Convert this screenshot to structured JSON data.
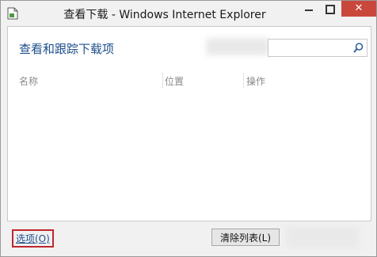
{
  "window": {
    "title": "查看下载 - Windows Internet Explorer",
    "close_glyph": "✕",
    "accent_close": "#c9483c"
  },
  "header": {
    "title": "查看和跟踪下载项",
    "search_placeholder": ""
  },
  "columns": [
    "名称",
    "位置",
    "操作"
  ],
  "footer": {
    "options_label": "选项(O)",
    "clear_list_label": "清除列表(L)"
  },
  "icons": {
    "app": "ie-page-icon",
    "search": "search-icon"
  },
  "colors": {
    "title_text": "#1e4e8c",
    "highlight_border": "#c0262d"
  }
}
